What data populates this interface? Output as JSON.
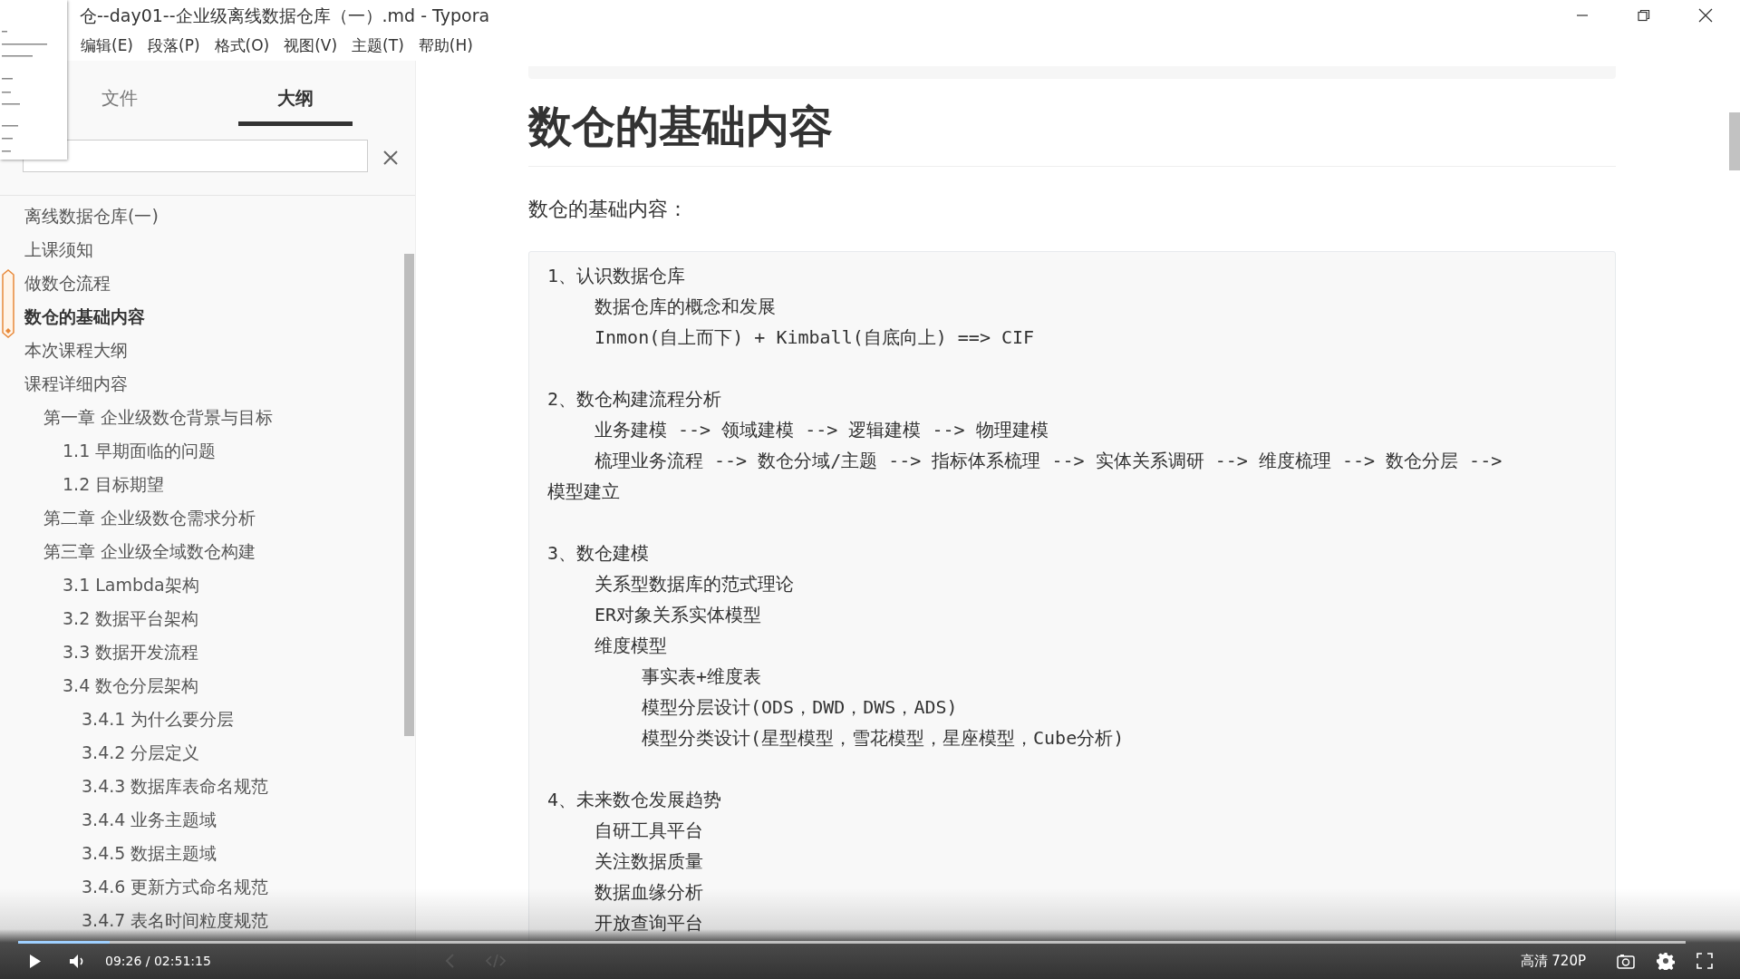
{
  "window": {
    "title": "仓--day01--企业级离线数据仓库（一）.md - Typora"
  },
  "menu": [
    "编辑(E)",
    "段落(P)",
    "格式(O)",
    "视图(V)",
    "主题(T)",
    "帮助(H)"
  ],
  "sidebar": {
    "tabs": [
      {
        "label": "文件",
        "selected": false
      },
      {
        "label": "大纲",
        "selected": true
      }
    ],
    "outline": [
      {
        "text": "离线数据仓库(一)",
        "selected": false
      },
      {
        "text": "上课须知",
        "selected": false
      },
      {
        "text": "做数仓流程",
        "selected": false
      },
      {
        "text": "数仓的基础内容",
        "selected": true
      },
      {
        "text": "本次课程大纲",
        "selected": false
      },
      {
        "text": "课程详细内容",
        "selected": false,
        "children": [
          {
            "text": "第一章 企业级数仓背景与目标",
            "selected": false,
            "children": [
              {
                "text": "1.1 早期面临的问题",
                "selected": false
              },
              {
                "text": "1.2 目标期望",
                "selected": false
              }
            ]
          },
          {
            "text": "第二章 企业级数仓需求分析",
            "selected": false
          },
          {
            "text": "第三章 企业级全域数仓构建",
            "selected": false,
            "children": [
              {
                "text": "3.1 Lambda架构",
                "selected": false
              },
              {
                "text": "3.2 数据平台架构",
                "selected": false
              },
              {
                "text": "3.3 数据开发流程",
                "selected": false
              },
              {
                "text": "3.4 数仓分层架构",
                "selected": false,
                "children": [
                  {
                    "text": "3.4.1 为什么要分层",
                    "selected": false
                  },
                  {
                    "text": "3.4.2 分层定义",
                    "selected": false
                  },
                  {
                    "text": "3.4.3 数据库表命名规范",
                    "selected": false
                  },
                  {
                    "text": "3.4.4 业务主题域",
                    "selected": false
                  },
                  {
                    "text": "3.4.5 数据主题域",
                    "selected": false
                  },
                  {
                    "text": "3.4.6 更新方式命名规范",
                    "selected": false
                  },
                  {
                    "text": "3.4.7 表名时间粒度规范",
                    "selected": false
                  }
                ]
              }
            ]
          }
        ]
      }
    ]
  },
  "content": {
    "heading": "数仓的基础内容",
    "intro": "数仓的基础内容：",
    "code": [
      {
        "heading": "1、认识数据仓库",
        "lines": [
          {
            "text": "数据仓库的概念和发展"
          },
          {
            "text": "Inmon(自上而下) + Kimball(自底向上) ==> CIF"
          }
        ]
      },
      {
        "heading": "2、数仓构建流程分析",
        "lines": [
          {
            "text": "业务建模 --> 领域建模 --> 逻辑建模 --> 物理建模"
          },
          {
            "text": "梳理业务流程 --> 数仓分域/主题 --> 指标体系梳理 --> 实体关系调研 --> 维度梳理 --> 数仓分层 --> 模型建立"
          }
        ]
      },
      {
        "heading": "3、数仓建模",
        "lines": [
          {
            "text": "关系型数据库的范式理论"
          },
          {
            "text": "ER对象关系实体模型"
          },
          {
            "text": "维度模型",
            "children": [
              {
                "text": "事实表+维度表"
              },
              {
                "text": "模型分层设计(ODS，DWD，DWS，ADS)"
              },
              {
                "text": "模型分类设计(星型模型，雪花模型，星座模型，Cube分析)"
              }
            ]
          }
        ]
      },
      {
        "heading": "4、未来数仓发展趋势",
        "lines": [
          {
            "text": "自研工具平台"
          },
          {
            "text": "关注数据质量"
          },
          {
            "text": "数据血缘分析"
          },
          {
            "text": "开放查询平台"
          }
        ]
      }
    ]
  },
  "player": {
    "time": "09:26 / 02:51:15",
    "level": 0.055,
    "quality": "高清 720P"
  }
}
